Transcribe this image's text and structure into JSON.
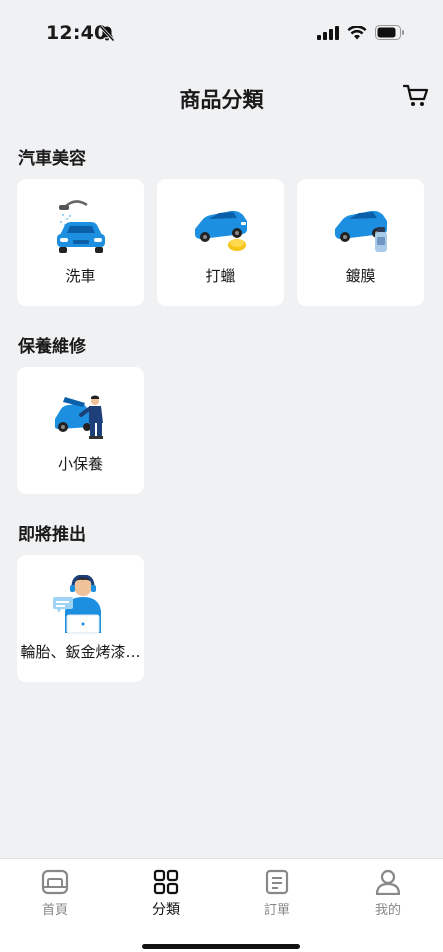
{
  "status_bar": {
    "time": "12:40"
  },
  "header": {
    "title": "商品分類",
    "cart_icon": "cart-icon"
  },
  "sections": [
    {
      "title": "汽車美容",
      "items": [
        {
          "label": "洗車",
          "icon": "car-wash-illustration"
        },
        {
          "label": "打蠟",
          "icon": "car-wax-illustration"
        },
        {
          "label": "鍍膜",
          "icon": "car-coating-illustration"
        }
      ]
    },
    {
      "title": "保養維修",
      "items": [
        {
          "label": "小保養",
          "icon": "car-maintenance-illustration"
        }
      ]
    },
    {
      "title": "即將推出",
      "items": [
        {
          "label": "輪胎、鈑金烤漆…",
          "icon": "customer-service-illustration"
        }
      ]
    }
  ],
  "tab_bar": [
    {
      "label": "首頁",
      "icon": "home-icon",
      "active": false
    },
    {
      "label": "分類",
      "icon": "category-grid-icon",
      "active": true
    },
    {
      "label": "訂單",
      "icon": "order-list-icon",
      "active": false
    },
    {
      "label": "我的",
      "icon": "profile-icon",
      "active": false
    }
  ],
  "colors": {
    "background": "#f0f1f3",
    "card": "#ffffff",
    "car_blue": "#1c8fe0",
    "active_tab": "#111111",
    "inactive_tab": "#888888"
  }
}
